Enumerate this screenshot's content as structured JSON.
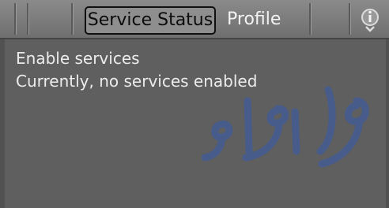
{
  "tabs": {
    "service_status_label": "Service Status",
    "profile_label": "Profile",
    "info_icon": "info-icon"
  },
  "content": {
    "enable_services": "Enable services",
    "status_message": "Currently, no services enabled"
  },
  "colors": {
    "screen_background": "#5f5f5f",
    "tab_bar": "#7a7a7a",
    "active_tab_background": "#8e8e8e",
    "active_tab_border": "#101010",
    "text": "#ececec",
    "watermark": "#3f5b9a"
  },
  "watermark": {
    "text": "رو فارما"
  }
}
